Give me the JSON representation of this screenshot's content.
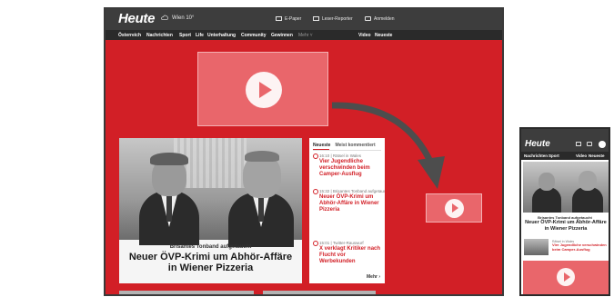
{
  "desktop": {
    "header": {
      "logo": "Heute",
      "weather": "Wien 10°",
      "utility": [
        {
          "label": "E-Paper",
          "icon": "newspaper-icon"
        },
        {
          "label": "Leser-Reporter",
          "icon": "camera-icon"
        },
        {
          "label": "Anmelden",
          "icon": "login-icon"
        }
      ]
    },
    "nav": {
      "items": [
        "Österreich",
        "Nachrichten",
        "Sport",
        "Life",
        "Unterhaltung",
        "Community",
        "Gewinnen"
      ],
      "more": "Mehr ˅",
      "right_items": [
        "Video",
        "Neueste"
      ]
    },
    "hero": {
      "kicker": "Brisantes Tonband aufgetaucht",
      "title": "Neuer ÖVP-Krimi um Abhör-Affäre in Wiener Pizzeria"
    },
    "sidebar": {
      "tabs": [
        "Neueste",
        "Meist kommentiert"
      ],
      "items": [
        {
          "meta": "16:10 | Rätsel in Wales",
          "headline": "Vier Jugendliche verschwinden beim Camper-Ausflug"
        },
        {
          "meta": "15:32 | Brisantes Tonband aufgetaucht",
          "headline": "Neuer ÖVP-Krimi um Abhör-Affäre in Wiener Pizzeria"
        },
        {
          "meta": "15:01 | Twitter-Rauswurf",
          "headline": "X verklagt Kritiker nach Flucht vor Werbekunden"
        }
      ],
      "more": "Mehr ›"
    }
  },
  "mobile": {
    "header": {
      "logo": "Heute"
    },
    "nav": [
      "Nachrichten",
      "Sport",
      "Video",
      "Neueste"
    ],
    "hero": {
      "kicker": "Brisantes Tonband aufgetaucht",
      "title": "Neuer ÖVP-Krimi um Abhör-Affäre in Wiener Pizzeria"
    },
    "item": {
      "meta": "Rätsel in Wales",
      "headline": "Vier Jugendliche verschwinden beim Camper-Ausflug"
    }
  },
  "colors": {
    "brand_red": "#d21f26",
    "video_placeholder": "#e9666b",
    "header_dark": "#3d3d3d",
    "arrow": "#4d4d4d"
  }
}
